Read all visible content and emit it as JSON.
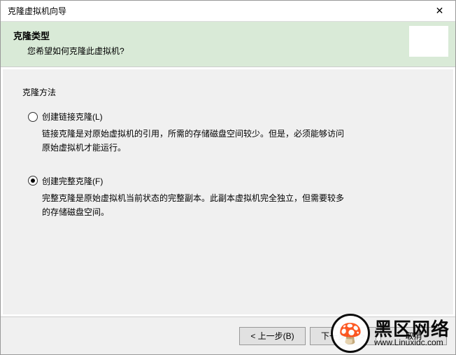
{
  "window": {
    "title": "克隆虚拟机向导"
  },
  "header": {
    "title": "克隆类型",
    "subtitle": "您希望如何克隆此虚拟机?"
  },
  "section": {
    "label": "克隆方法"
  },
  "options": {
    "linked": {
      "label": "创建链接克隆(L)",
      "desc": "链接克隆是对原始虚拟机的引用，所需的存储磁盘空间较少。但是，必须能够访问原始虚拟机才能运行。",
      "selected": false
    },
    "full": {
      "label": "创建完整克隆(F)",
      "desc": "完整克隆是原始虚拟机当前状态的完整副本。此副本虚拟机完全独立，但需要较多的存储磁盘空间。",
      "selected": true
    }
  },
  "buttons": {
    "back": "< 上一步(B)",
    "next": "下一步(N) >",
    "cancel": "取消"
  },
  "watermark": {
    "main": "黑区网络",
    "sub": "www.Linuxidc.com"
  }
}
